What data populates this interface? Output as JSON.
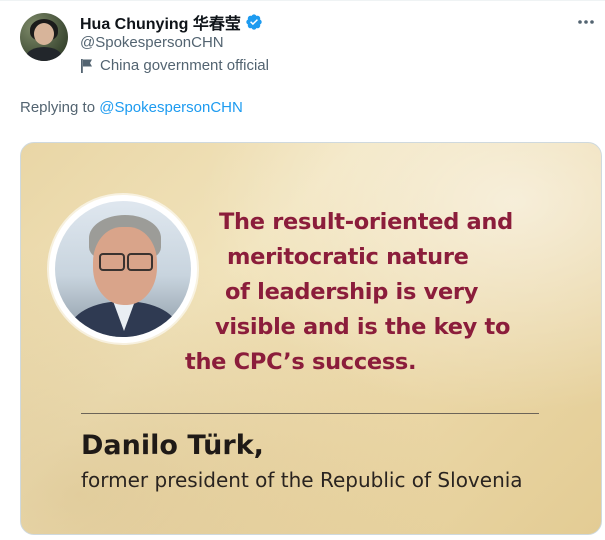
{
  "tweet": {
    "display_name": "Hua Chunying 华春莹",
    "handle": "@SpokespersonCHN",
    "account_label": "China government official",
    "replying_prefix": "Replying to",
    "replying_to": "@SpokespersonCHN",
    "icons": {
      "verified": "verified-badge-icon",
      "label": "flag-icon",
      "more": "more-dots-icon"
    },
    "colors": {
      "link": "#1d9bf0",
      "verified": "#1d9bf0",
      "secondary_text": "#536471",
      "quote_text": "#8b1d3b"
    }
  },
  "media": {
    "quote_lines": [
      "The result-oriented and",
      "meritocratic nature",
      "of leadership is very",
      "visible and is the key to",
      "the CPC’s success."
    ],
    "author_name": "Danilo Türk,",
    "author_title": "former president of the Republic of Slovenia"
  }
}
